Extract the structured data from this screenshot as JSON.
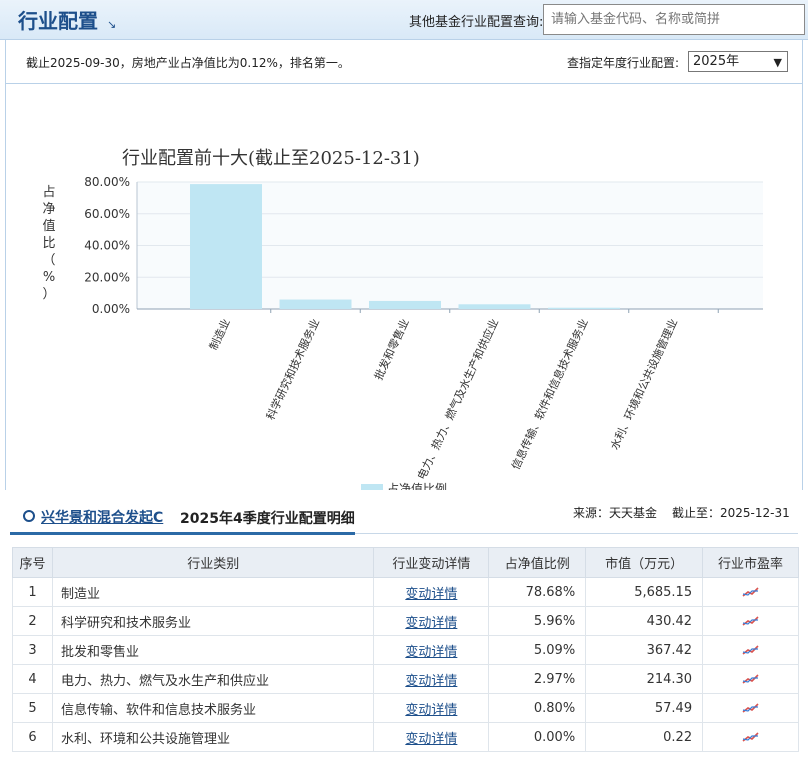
{
  "header": {
    "title": "行业配置",
    "query_label": "其他基金行业配置查询:",
    "query_placeholder": "请输入基金代码、名称或简拼"
  },
  "infobar": {
    "note": "截止2025-09-30，房地产业占净值比为0.12%，排名第一。",
    "year_label": "查指定年度行业配置:",
    "year_value": "2025年"
  },
  "chart_data": {
    "type": "bar",
    "title": "行业配置前十大(截止至2025-12-31)",
    "ylabel": "占净值比（%）",
    "ylim": [
      0,
      80
    ],
    "yticks": [
      "80.00%",
      "60.00%",
      "40.00%",
      "20.00%",
      "0.00%"
    ],
    "categories": [
      "制造业",
      "科学研究和技术服务业",
      "批发和零售业",
      "电力、热力、燃气及水生产和供应业",
      "信息传输、软件和信息技术服务业",
      "水利、环境和公共设施管理业"
    ],
    "series": [
      {
        "name": "占净值比例",
        "values": [
          78.68,
          5.96,
          5.09,
          2.97,
          0.8,
          0.0
        ]
      }
    ],
    "legend": "bottom-center",
    "grid": true,
    "color": "#bfe6f3"
  },
  "detail": {
    "fund_name": "兴华景和混合发起C",
    "section_title": "2025年4季度行业配置明细",
    "source": "来源：天天基金",
    "as_of": "截止至：2025-12-31",
    "columns": [
      "序号",
      "行业类别",
      "行业变动详情",
      "占净值比例",
      "市值（万元）",
      "行业市盈率"
    ],
    "link_label": "变动详情",
    "rows": [
      {
        "no": "1",
        "industry": "制造业",
        "pct": "78.68%",
        "mv": "5,685.15"
      },
      {
        "no": "2",
        "industry": "科学研究和技术服务业",
        "pct": "5.96%",
        "mv": "430.42"
      },
      {
        "no": "3",
        "industry": "批发和零售业",
        "pct": "5.09%",
        "mv": "367.42"
      },
      {
        "no": "4",
        "industry": "电力、热力、燃气及水生产和供应业",
        "pct": "2.97%",
        "mv": "214.30"
      },
      {
        "no": "5",
        "industry": "信息传输、软件和信息技术服务业",
        "pct": "0.80%",
        "mv": "57.49"
      },
      {
        "no": "6",
        "industry": "水利、环境和公共设施管理业",
        "pct": "0.00%",
        "mv": "0.22"
      }
    ]
  }
}
